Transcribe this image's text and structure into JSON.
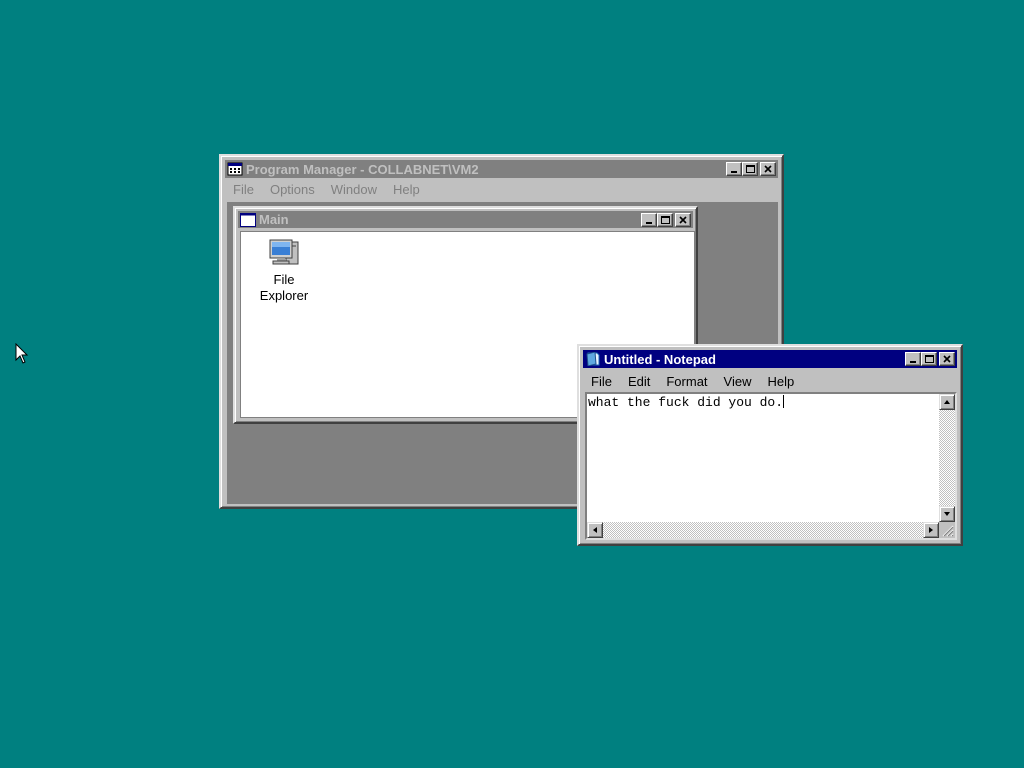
{
  "desktop": {
    "background_color": "#008080"
  },
  "program_manager": {
    "title": "Program Manager - COLLABNET\\VM2",
    "title_icon": "program-manager-icon",
    "menu": [
      "File",
      "Options",
      "Window",
      "Help"
    ],
    "buttons": [
      "minimize-icon",
      "maximize-icon",
      "close-icon"
    ],
    "main_group": {
      "title": "Main",
      "icons": [
        {
          "label_line1": "File",
          "label_line2": "Explorer",
          "icon": "file-explorer-icon"
        }
      ]
    }
  },
  "notepad": {
    "title": "Untitled - Notepad",
    "title_icon": "notepad-icon",
    "menu": [
      "File",
      "Edit",
      "Format",
      "View",
      "Help"
    ],
    "content": "what the fuck did you do.",
    "buttons": [
      "minimize-icon",
      "maximize-icon",
      "close-icon"
    ]
  },
  "colors": {
    "active_title": "#000080",
    "inactive_title": "#808080",
    "face": "#c0c0c0"
  }
}
